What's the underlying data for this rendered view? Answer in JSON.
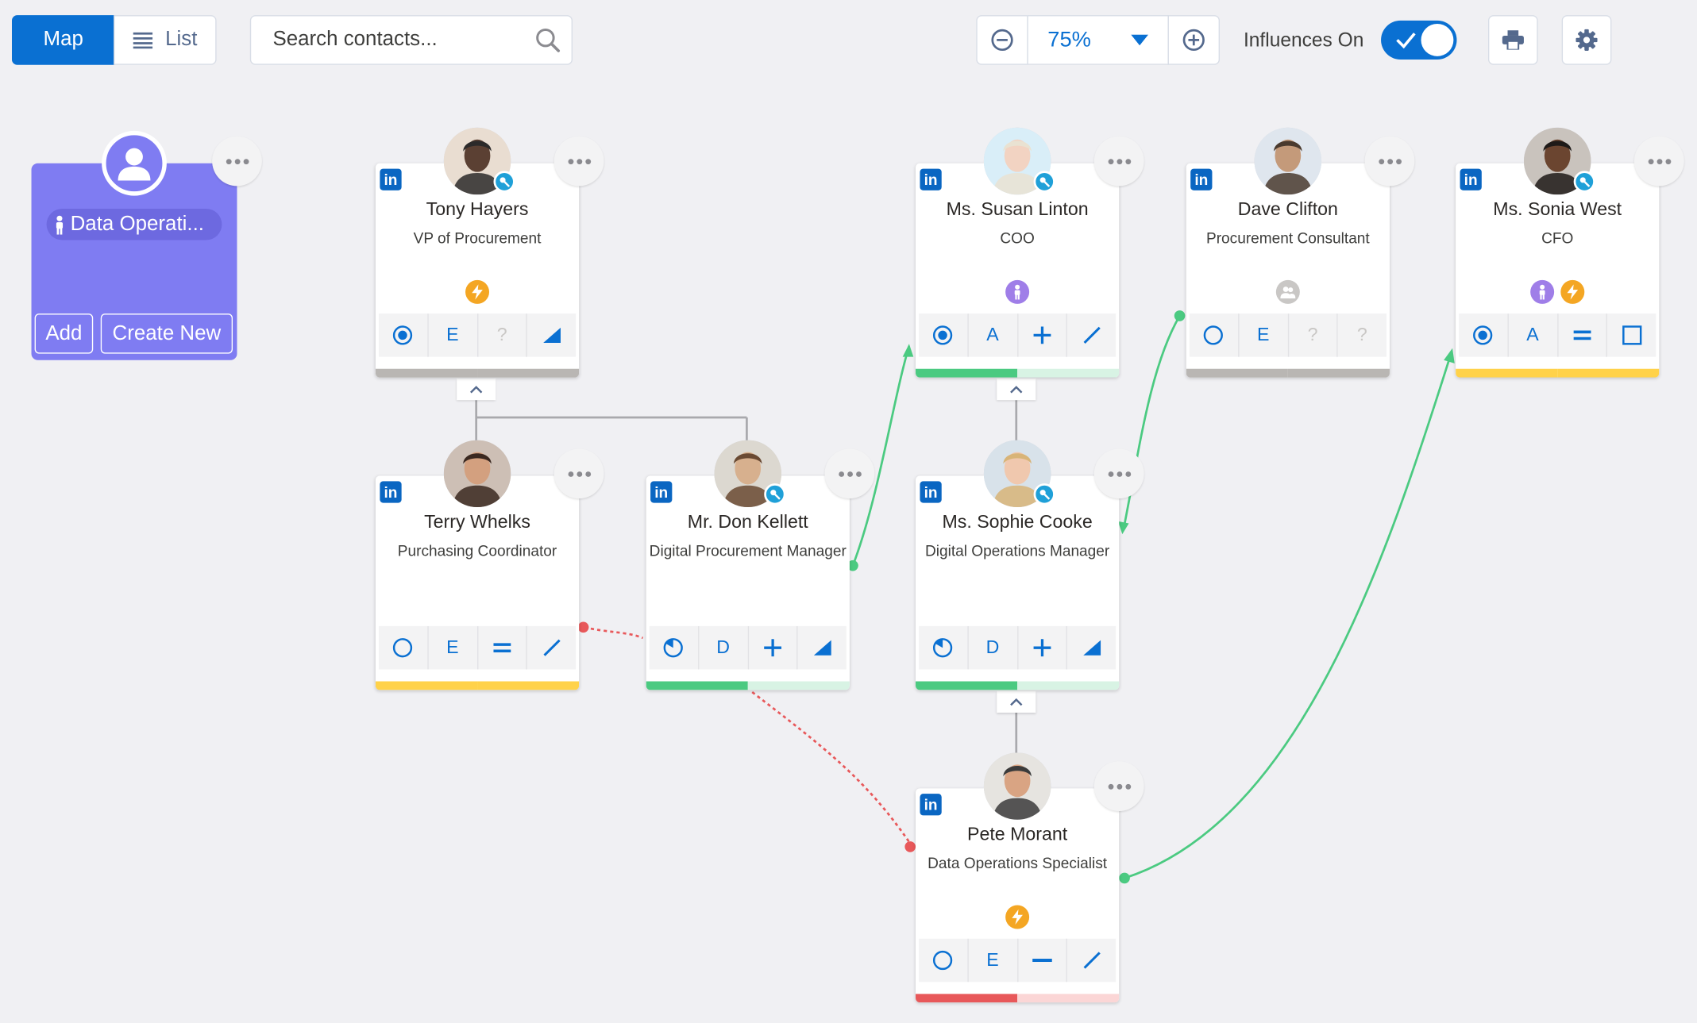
{
  "toolbar": {
    "map_label": "Map",
    "list_label": "List",
    "search_placeholder": "Search contacts...",
    "zoom_level": "75%",
    "influences_label": "Influences On",
    "influences_on": true
  },
  "group": {
    "label": "Data Operati...",
    "add_label": "Add",
    "create_label": "Create New"
  },
  "colors": {
    "accent": "#0a70d2",
    "group": "#7f7cf2",
    "green": "#4bca81",
    "red": "#e8585a",
    "yellow": "#ffd24a",
    "gray": "#b9b6b3"
  },
  "contacts": [
    {
      "name": "Tony Hayers",
      "title": "VP of Procurement",
      "actions": [
        "target-full",
        "E",
        "?",
        "wedge"
      ],
      "badges": [
        "lightning"
      ]
    },
    {
      "name": "Ms. Susan Linton",
      "title": "COO",
      "actions": [
        "target-full",
        "A",
        "plus",
        "slash"
      ],
      "badges": [
        "person"
      ]
    },
    {
      "name": "Dave Clifton",
      "title": "Procurement Consultant",
      "actions": [
        "circle-empty",
        "E",
        "?",
        "?"
      ],
      "badges": [
        "people-gray"
      ]
    },
    {
      "name": "Ms. Sonia West",
      "title": "CFO",
      "actions": [
        "target-full",
        "A",
        "equals",
        "square"
      ],
      "badges": [
        "person",
        "lightning"
      ]
    },
    {
      "name": "Terry Whelks",
      "title": "Purchasing Coordinator",
      "actions": [
        "circle-empty",
        "E",
        "equals",
        "slash"
      ],
      "badges": []
    },
    {
      "name": "Mr. Don Kellett",
      "title": "Digital Procurement Manager",
      "actions": [
        "circle-quarter",
        "D",
        "plus",
        "wedge"
      ],
      "badges": []
    },
    {
      "name": "Ms. Sophie Cooke",
      "title": "Digital Operations Manager",
      "actions": [
        "circle-quarter",
        "D",
        "plus",
        "wedge"
      ],
      "badges": []
    },
    {
      "name": "Pete Morant",
      "title": "Data Operations Specialist",
      "actions": [
        "circle-empty",
        "E",
        "minus",
        "slash"
      ],
      "badges": [
        "lightning"
      ]
    }
  ]
}
